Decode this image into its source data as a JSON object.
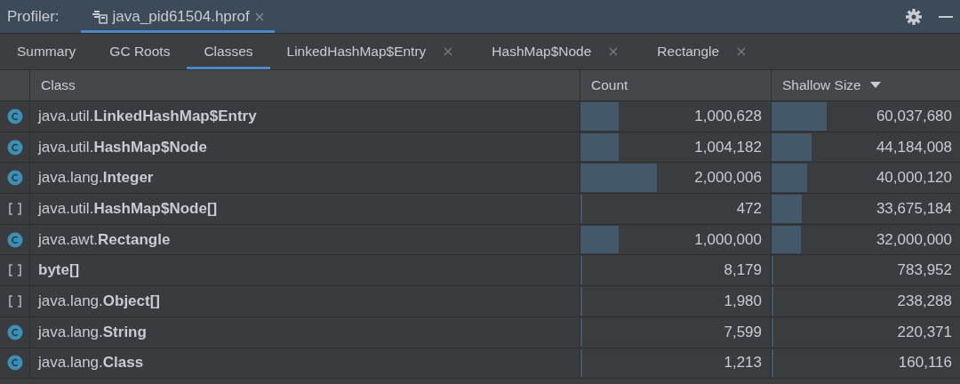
{
  "toolbar": {
    "label": "Profiler:",
    "file_tab": {
      "title": "java_pid61504.hprof",
      "selected": true
    }
  },
  "tabs": [
    {
      "label": "Summary",
      "selected": false,
      "closable": false
    },
    {
      "label": "GC Roots",
      "selected": false,
      "closable": false
    },
    {
      "label": "Classes",
      "selected": true,
      "closable": false
    },
    {
      "label": "LinkedHashMap$Entry",
      "selected": false,
      "closable": true
    },
    {
      "label": "HashMap$Node",
      "selected": false,
      "closable": true
    },
    {
      "label": "Rectangle",
      "selected": false,
      "closable": true
    }
  ],
  "table": {
    "columns": [
      {
        "label": "Class",
        "sorted": false
      },
      {
        "label": "Count",
        "sorted": false
      },
      {
        "label": "Shallow Size",
        "sorted": true
      }
    ],
    "rows": [
      {
        "kind": "class",
        "class": "java.util.**LinkedHashMap$Entry**",
        "count": "1,000,628",
        "count_bar": {
          "level": 0.2
        },
        "shallow_size": "60,037,680",
        "size_bar": {
          "level": 0.29
        }
      },
      {
        "kind": "class",
        "class": "java.util.**HashMap$Node**",
        "count": "1,004,182",
        "count_bar": {
          "level": 0.2
        },
        "shallow_size": "44,184,008",
        "size_bar": {
          "level": 0.21
        }
      },
      {
        "kind": "class",
        "class": "java.lang.**Integer**",
        "count": "2,000,006",
        "count_bar": {
          "level": 0.4
        },
        "shallow_size": "40,000,120",
        "size_bar": {
          "level": 0.19
        }
      },
      {
        "kind": "array",
        "class": "java.util.**HashMap$Node[]**",
        "count": "472",
        "count_bar": {
          "level": 0.005
        },
        "shallow_size": "33,675,184",
        "size_bar": {
          "level": 0.16
        }
      },
      {
        "kind": "class",
        "class": "java.awt.**Rectangle**",
        "count": "1,000,000",
        "count_bar": {
          "level": 0.2
        },
        "shallow_size": "32,000,000",
        "size_bar": {
          "level": 0.155
        }
      },
      {
        "kind": "array",
        "class": "**byte[]**",
        "count": "8,179",
        "count_bar": {
          "level": 0.005
        },
        "shallow_size": "783,952",
        "size_bar": {
          "level": 0.005
        }
      },
      {
        "kind": "array",
        "class": "java.lang.**Object[]**",
        "count": "1,980",
        "count_bar": {
          "level": 0.005
        },
        "shallow_size": "238,288",
        "size_bar": {
          "level": 0.005
        }
      },
      {
        "kind": "class",
        "class": "java.lang.**String**",
        "count": "7,599",
        "count_bar": {
          "level": 0.005
        },
        "shallow_size": "220,371",
        "size_bar": {
          "level": 0.005
        }
      },
      {
        "kind": "class",
        "class": "java.lang.**Class**",
        "count": "1,213",
        "count_bar": {
          "level": 0.005
        },
        "shallow_size": "160,116",
        "size_bar": {
          "level": 0.005
        }
      }
    ]
  }
}
